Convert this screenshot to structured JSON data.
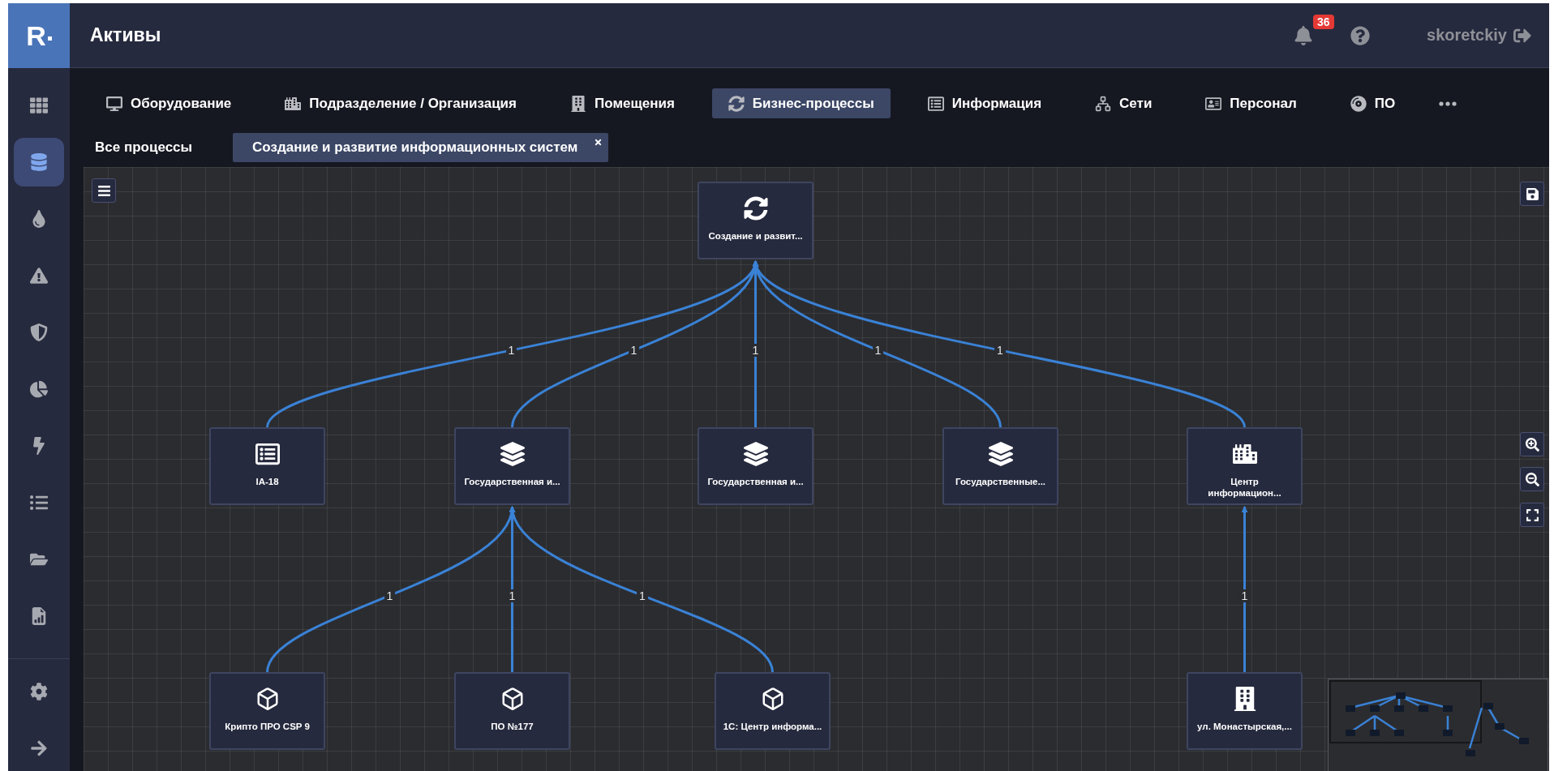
{
  "header": {
    "logo": "R",
    "title": "Активы",
    "notifications": "36",
    "user": "skoretckiy"
  },
  "sidebar": {
    "items": [
      {
        "selected": false
      },
      {
        "selected": true
      },
      {
        "selected": false
      },
      {
        "selected": false
      },
      {
        "selected": false
      },
      {
        "selected": false
      },
      {
        "selected": false
      },
      {
        "selected": false
      },
      {
        "selected": false
      },
      {
        "selected": false
      }
    ],
    "bottom_items": [
      {
        "selected": false
      },
      {
        "selected": false
      }
    ]
  },
  "tabs": [
    {
      "label": "Оборудование",
      "selected": false
    },
    {
      "label": "Подразделение / Организация",
      "selected": false
    },
    {
      "label": "Помещения",
      "selected": false
    },
    {
      "label": "Бизнес-процессы",
      "selected": true
    },
    {
      "label": "Информация",
      "selected": false
    },
    {
      "label": "Сети",
      "selected": false
    },
    {
      "label": "Персонал",
      "selected": false
    },
    {
      "label": "ПО",
      "selected": false
    }
  ],
  "subtabs": [
    {
      "label": "Все процессы",
      "selected": false,
      "closable": false
    },
    {
      "label": "Создание и развитие информационных систем",
      "selected": true,
      "closable": true
    }
  ],
  "graph": {
    "root": {
      "kind": "process",
      "label": "Создание и развит...",
      "children": [
        {
          "kind": "document",
          "label": "IA-18",
          "link_label": "1"
        },
        {
          "kind": "system",
          "label": "Государственная и...",
          "link_label": "1",
          "children": [
            {
              "kind": "software",
              "label": "Крипто ПРО CSP 9",
              "link_label": "1"
            },
            {
              "kind": "software",
              "label": "ПО №177",
              "link_label": "1"
            },
            {
              "kind": "software",
              "label": "1С: Центр информа...",
              "link_label": "1"
            }
          ]
        },
        {
          "kind": "system",
          "label": "Государственная и...",
          "link_label": "1"
        },
        {
          "kind": "system",
          "label": "Государственные...",
          "link_label": "1"
        },
        {
          "kind": "organization",
          "label": "Центр информацион...",
          "link_label": "1",
          "children": [
            {
              "kind": "premises",
              "label": "ул. Монастырская,...",
              "link_label": "1"
            }
          ]
        }
      ]
    }
  }
}
